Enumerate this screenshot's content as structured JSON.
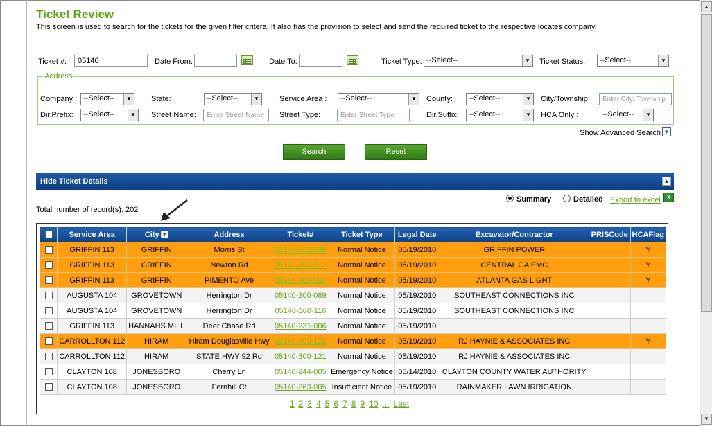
{
  "page": {
    "title": "Ticket Review",
    "description": "This screen is used to search for the tickets for the given filter critera. It also has the provision to select and send the required ticket to the respective locates company."
  },
  "filters": {
    "ticket_label": "Ticket #:",
    "ticket_value": "05140",
    "date_from_label": "Date From:",
    "date_to_label": "Date To:",
    "ticket_type_label": "Ticket Type:",
    "ticket_type_value": "--Select--",
    "ticket_status_label": "Ticket Status:",
    "ticket_status_value": "--Select--"
  },
  "address": {
    "legend": "Address",
    "company_label": "Company :",
    "company_value": "--Select--",
    "state_label": "State:",
    "state_value": "--Select--",
    "service_area_label": "Service Area :",
    "service_area_value": "--Select--",
    "county_label": "County:",
    "county_value": "--Select--",
    "city_label": "City/Township:",
    "city_placeholder": "Enter City/ Township",
    "dir_prefix_label": "Dir.Prefix:",
    "dir_prefix_value": "--Select--",
    "street_name_label": "Street Name:",
    "street_name_placeholder": "Enter Street Name",
    "street_type_label": "Street Type:",
    "street_type_placeholder": "Enter Street Type",
    "dir_suffix_label": "Dir.Suffix:",
    "dir_suffix_value": "--Select--",
    "hca_only_label": "HCA Only :",
    "hca_only_value": "--Select--"
  },
  "advanced_search": "Show Advanced Search",
  "buttons": {
    "search": "Search",
    "reset": "Reset"
  },
  "details": {
    "band_title": "Hide Ticket Details",
    "total_label": "Total number of record(s): 202",
    "summary_label": "Summary",
    "detailed_label": "Detailed",
    "export_label": "Export to excel",
    "xls_icon_text": "X"
  },
  "table": {
    "columns": [
      "Service Area",
      "City",
      "Address",
      "Ticket#",
      "Ticket Type",
      "Legal Date",
      "Excavator/Contractor",
      "PRISCode",
      "HCAFlag"
    ],
    "rows": [
      {
        "hca": true,
        "service_area": "GRIFFIN 113",
        "city": "GRIFFIN",
        "address": "Morris St",
        "ticket": "05140-300-039",
        "type": "Normal Notice",
        "date": "05/19/2010",
        "excavator": "GRIFFIN POWER",
        "pris": "",
        "flag": "Y"
      },
      {
        "hca": true,
        "service_area": "GRIFFIN 113",
        "city": "GRIFFIN",
        "address": "Newton Rd",
        "ticket": "05140-300-012",
        "type": "Normal Notice",
        "date": "05/19/2010",
        "excavator": "CENTRAL GA EMC",
        "pris": "",
        "flag": "Y"
      },
      {
        "hca": true,
        "service_area": "GRIFFIN 113",
        "city": "GRIFFIN",
        "address": "PIMENTO Ave",
        "ticket": "05140-300-007",
        "type": "Normal Notice",
        "date": "05/19/2010",
        "excavator": "ATLANTA GAS LIGHT",
        "pris": "",
        "flag": "Y"
      },
      {
        "hca": false,
        "service_area": "AUGUSTA 104",
        "city": "GROVETOWN",
        "address": "Herrington Dr",
        "ticket": "05140-300-089",
        "type": "Normal Notice",
        "date": "05/19/2010",
        "excavator": "SOUTHEAST CONNECTIONS INC",
        "pris": "",
        "flag": ""
      },
      {
        "hca": false,
        "service_area": "AUGUSTA 104",
        "city": "GROVETOWN",
        "address": "Herrington Dr",
        "ticket": "05140-300-116",
        "type": "Normal Notice",
        "date": "05/19/2010",
        "excavator": "SOUTHEAST CONNECTIONS INC",
        "pris": "",
        "flag": ""
      },
      {
        "hca": false,
        "service_area": "GRIFFIN 113",
        "city": "HANNAHS MILL",
        "address": "Deer Chase Rd",
        "ticket": "05140-231-006",
        "type": "Normal Notice",
        "date": "05/19/2010",
        "excavator": "",
        "pris": "",
        "flag": ""
      },
      {
        "hca": true,
        "service_area": "CARROLLTON 112",
        "city": "HIRAM",
        "address": "Hiram Douglasville Hwy",
        "ticket": "05140-300-122",
        "type": "Normal Notice",
        "date": "05/19/2010",
        "excavator": "RJ HAYNIE & ASSOCIATES INC",
        "pris": "",
        "flag": "Y"
      },
      {
        "hca": false,
        "service_area": "CARROLLTON 112",
        "city": "HIRAM",
        "address": "STATE HWY 92 Rd",
        "ticket": "05140-300-121",
        "type": "Normal Notice",
        "date": "05/19/2010",
        "excavator": "RJ HAYNIE & ASSOCIATES INC",
        "pris": "",
        "flag": ""
      },
      {
        "hca": false,
        "service_area": "CLAYTON 108",
        "city": "JONESBORO",
        "address": "Cherry Ln",
        "ticket": "05140-244-005",
        "type": "Emergency Notice",
        "date": "05/14/2010",
        "excavator": "CLAYTON COUNTY WATER AUTHORITY",
        "pris": "",
        "flag": ""
      },
      {
        "hca": false,
        "service_area": "CLAYTON 108",
        "city": "JONESBORO",
        "address": "Fernhill Ct",
        "ticket": "05140-263-005",
        "type": "Insufficient Notice",
        "date": "05/19/2010",
        "excavator": "RAINMAKER LAWN IRRIGATION",
        "pris": "",
        "flag": ""
      }
    ]
  },
  "pager": [
    "1",
    "2",
    "3",
    "4",
    "5",
    "6",
    "7",
    "8",
    "9",
    "10",
    "...",
    "Last"
  ]
}
